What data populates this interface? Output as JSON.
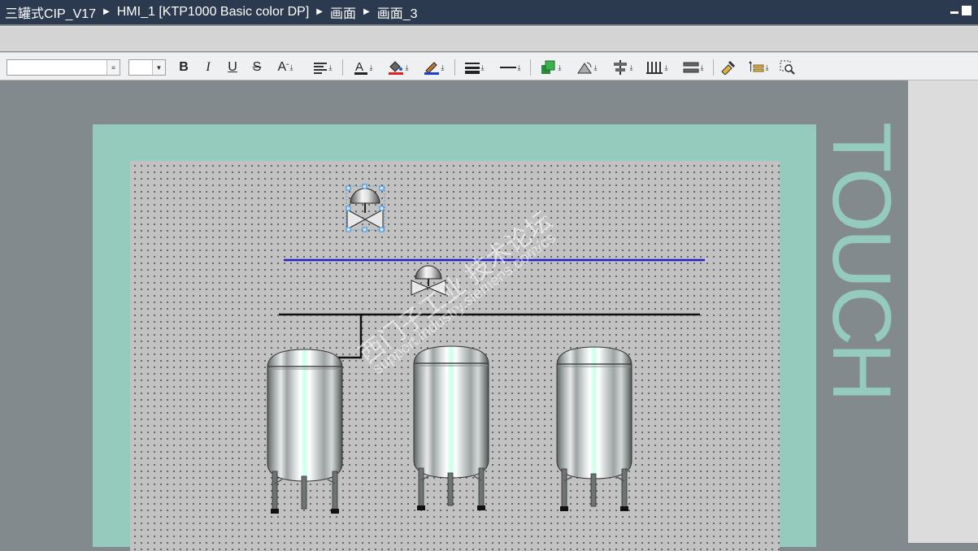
{
  "titlebar": {
    "breadcrumbs": [
      "三罐式CIP_V17",
      "HMI_1 [KTP1000 Basic color DP]",
      "画面",
      "画面_3"
    ]
  },
  "device": {
    "brand_text": "TOUCH",
    "frame_color": "#95cbbc"
  },
  "toolbar": {
    "font_name_value": "",
    "font_size_value": "",
    "bold_label": "B",
    "italic_label": "I",
    "underline_label": "U",
    "strike_label": "S",
    "font_grow_label": "A"
  },
  "watermark": {
    "line1": "西门子工业 技术论坛",
    "line2": "support.industry.siemens.com/cs"
  },
  "colors": {
    "pipe_selected": "#2020c8",
    "pipe": "#111111",
    "selection_handle": "#3a8fe0"
  }
}
